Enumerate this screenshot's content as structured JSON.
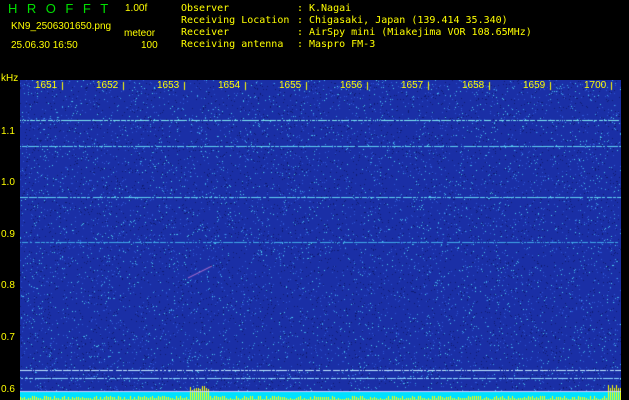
{
  "header": {
    "app_title": "HROFFT",
    "version": "1.00f",
    "filename": "KN9_2506301650.png",
    "meteor_label": "meteor",
    "datetime": "25.06.30 16:50",
    "count": "100"
  },
  "info": {
    "observer_label": "Observer",
    "observer": "K.Nagai",
    "location_label": "Receiving Location",
    "location": "Chigasaki, Japan (139.414 35.340)",
    "receiver_label": "Receiver",
    "receiver": "AirSpy mini (Miakejima VOR 108.65MHz)",
    "antenna_label": "Receiving antenna",
    "antenna": "Maspro FM-3"
  },
  "chart_data": {
    "type": "heatmap",
    "ylabel": "kHz",
    "x_ticks": [
      "1651",
      "1652",
      "1653",
      "1654",
      "1655",
      "1656",
      "1657",
      "1658",
      "1659",
      "1700"
    ],
    "y_ticks": [
      "1.1",
      "1.0",
      "0.9",
      "0.8",
      "0.7",
      "0.6"
    ],
    "ylim": [
      0.58,
      1.2
    ],
    "colors": {
      "background": "#1a2fa6",
      "noise": "#4fd3f0",
      "axis": "#ffff00",
      "bottom_bar": "#00e0ff"
    }
  }
}
